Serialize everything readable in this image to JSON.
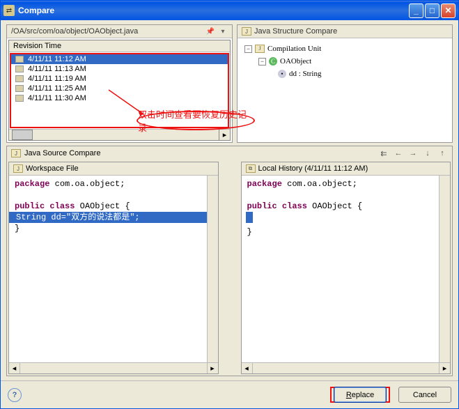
{
  "title": "Compare",
  "path": "/OA/src/com/oa/object/OAObject.java",
  "revision_header": "Revision Time",
  "revisions": [
    {
      "time": "4/11/11 11:12 AM",
      "selected": true
    },
    {
      "time": "4/11/11 11:13 AM",
      "selected": false
    },
    {
      "time": "4/11/11 11:19 AM",
      "selected": false
    },
    {
      "time": "4/11/11 11:25 AM",
      "selected": false
    },
    {
      "time": "4/11/11 11:30 AM",
      "selected": false
    }
  ],
  "annotation_text": "双击时间查看要恢复历史记录",
  "structure": {
    "title": "Java Structure Compare",
    "unit": "Compilation Unit",
    "class": "OAObject",
    "field": "dd : String"
  },
  "source_compare_title": "Java Source Compare",
  "left": {
    "title": "Workspace File",
    "code": {
      "pkg_kw": "package",
      "pkg": " com.oa.object;",
      "pub_kw": "public",
      "cls_kw": " class",
      "cls": " OAObject {",
      "line": "  String dd=\"双方的说法都是\";",
      "close": "}"
    }
  },
  "right": {
    "title": "Local History (4/11/11 11:12 AM)",
    "code": {
      "pkg_kw": "package",
      "pkg": " com.oa.object;",
      "pub_kw": "public",
      "cls_kw": " class",
      "cls": " OAObject {",
      "close": "}"
    }
  },
  "buttons": {
    "replace": "Replace",
    "cancel": "Cancel"
  }
}
